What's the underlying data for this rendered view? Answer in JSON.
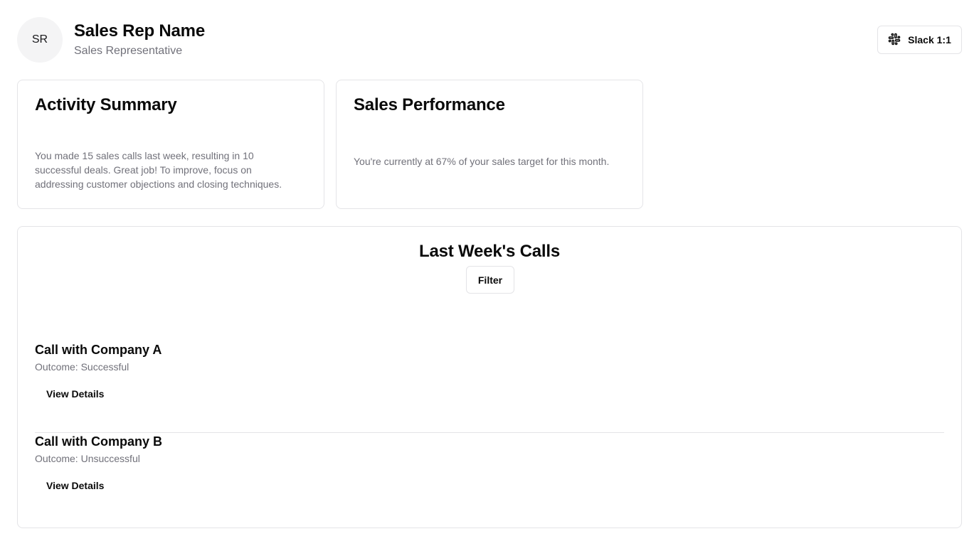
{
  "header": {
    "avatar_initials": "SR",
    "name": "Sales Rep Name",
    "role": "Sales Representative",
    "slack_button": {
      "label": "Slack 1:1",
      "icon": "slack-icon"
    }
  },
  "activity_summary": {
    "title": "Activity Summary",
    "text": "You made 15 sales calls last week, resulting in 10 successful deals. Great job! To improve, focus on addressing customer objections and closing techniques."
  },
  "sales_performance": {
    "title": "Sales Performance",
    "text": "You're currently at 67% of your sales target for this month."
  },
  "calls": {
    "title": "Last Week's Calls",
    "filter_label": "Filter",
    "items": [
      {
        "title": "Call with Company A",
        "outcome": "Outcome: Successful",
        "action_label": "View Details"
      },
      {
        "title": "Call with Company B",
        "outcome": "Outcome: Unsuccessful",
        "action_label": "View Details"
      }
    ]
  },
  "colors": {
    "text_primary": "#0a0a0a",
    "text_muted": "#71717a",
    "border": "#e4e4e7",
    "avatar_bg": "#f4f4f5"
  }
}
